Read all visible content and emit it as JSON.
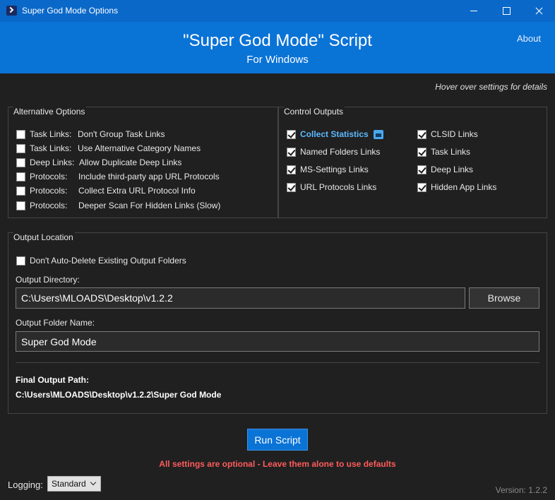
{
  "window": {
    "title": "Super God Mode Options"
  },
  "header": {
    "title": "\"Super God Mode\" Script",
    "subtitle": "For Windows",
    "about_label": "About"
  },
  "hover_hint": "Hover over settings for details",
  "alternative_options": {
    "title": "Alternative Options",
    "items": [
      {
        "prefix": "Task Links:",
        "label": "Don't Group Task Links",
        "checked": false
      },
      {
        "prefix": "Task Links:",
        "label": "Use Alternative Category Names",
        "checked": false
      },
      {
        "prefix": "Deep Links:",
        "label": "Allow Duplicate Deep Links",
        "checked": false
      },
      {
        "prefix": "Protocols:",
        "label": "Include third-party app URL Protocols",
        "checked": false
      },
      {
        "prefix": "Protocols:",
        "label": "Collect Extra URL Protocol Info",
        "checked": false
      },
      {
        "prefix": "Protocols:",
        "label": "Deeper Scan For Hidden Links (Slow)",
        "checked": false
      }
    ]
  },
  "control_outputs": {
    "title": "Control Outputs",
    "left": [
      {
        "label": "Collect Statistics",
        "checked": true
      },
      {
        "label": "Named Folders Links",
        "checked": true
      },
      {
        "label": "MS-Settings Links",
        "checked": true
      },
      {
        "label": "URL Protocols Links",
        "checked": true
      }
    ],
    "right": [
      {
        "label": "CLSID Links",
        "checked": true
      },
      {
        "label": "Task Links",
        "checked": true
      },
      {
        "label": "Deep Links",
        "checked": true
      },
      {
        "label": "Hidden App Links",
        "checked": true
      }
    ]
  },
  "output_location": {
    "title": "Output Location",
    "no_auto_delete_label": "Don't Auto-Delete Existing Output Folders",
    "no_auto_delete_checked": false,
    "directory_label": "Output Directory:",
    "directory_value": "C:\\Users\\MLOADS\\Desktop\\v1.2.2",
    "browse_label": "Browse",
    "folder_name_label": "Output Folder Name:",
    "folder_name_value": "Super God Mode",
    "final_path_label": "Final Output Path:",
    "final_path_value": "C:\\Users\\MLOADS\\Desktop\\v1.2.2\\Super God Mode"
  },
  "run_button_label": "Run Script",
  "note": "All settings are optional - Leave them alone to use defaults",
  "logging": {
    "label": "Logging:",
    "selected": "Standard"
  },
  "version": "Version: 1.2.2",
  "colors": {
    "titlebar": "#0a68c9",
    "header": "#0a73d6",
    "background": "#202020",
    "note": "#ff5b5b",
    "stat_label": "#5cb9ff"
  },
  "icons": {
    "app": "powershell-icon",
    "stats": "info-icon"
  }
}
